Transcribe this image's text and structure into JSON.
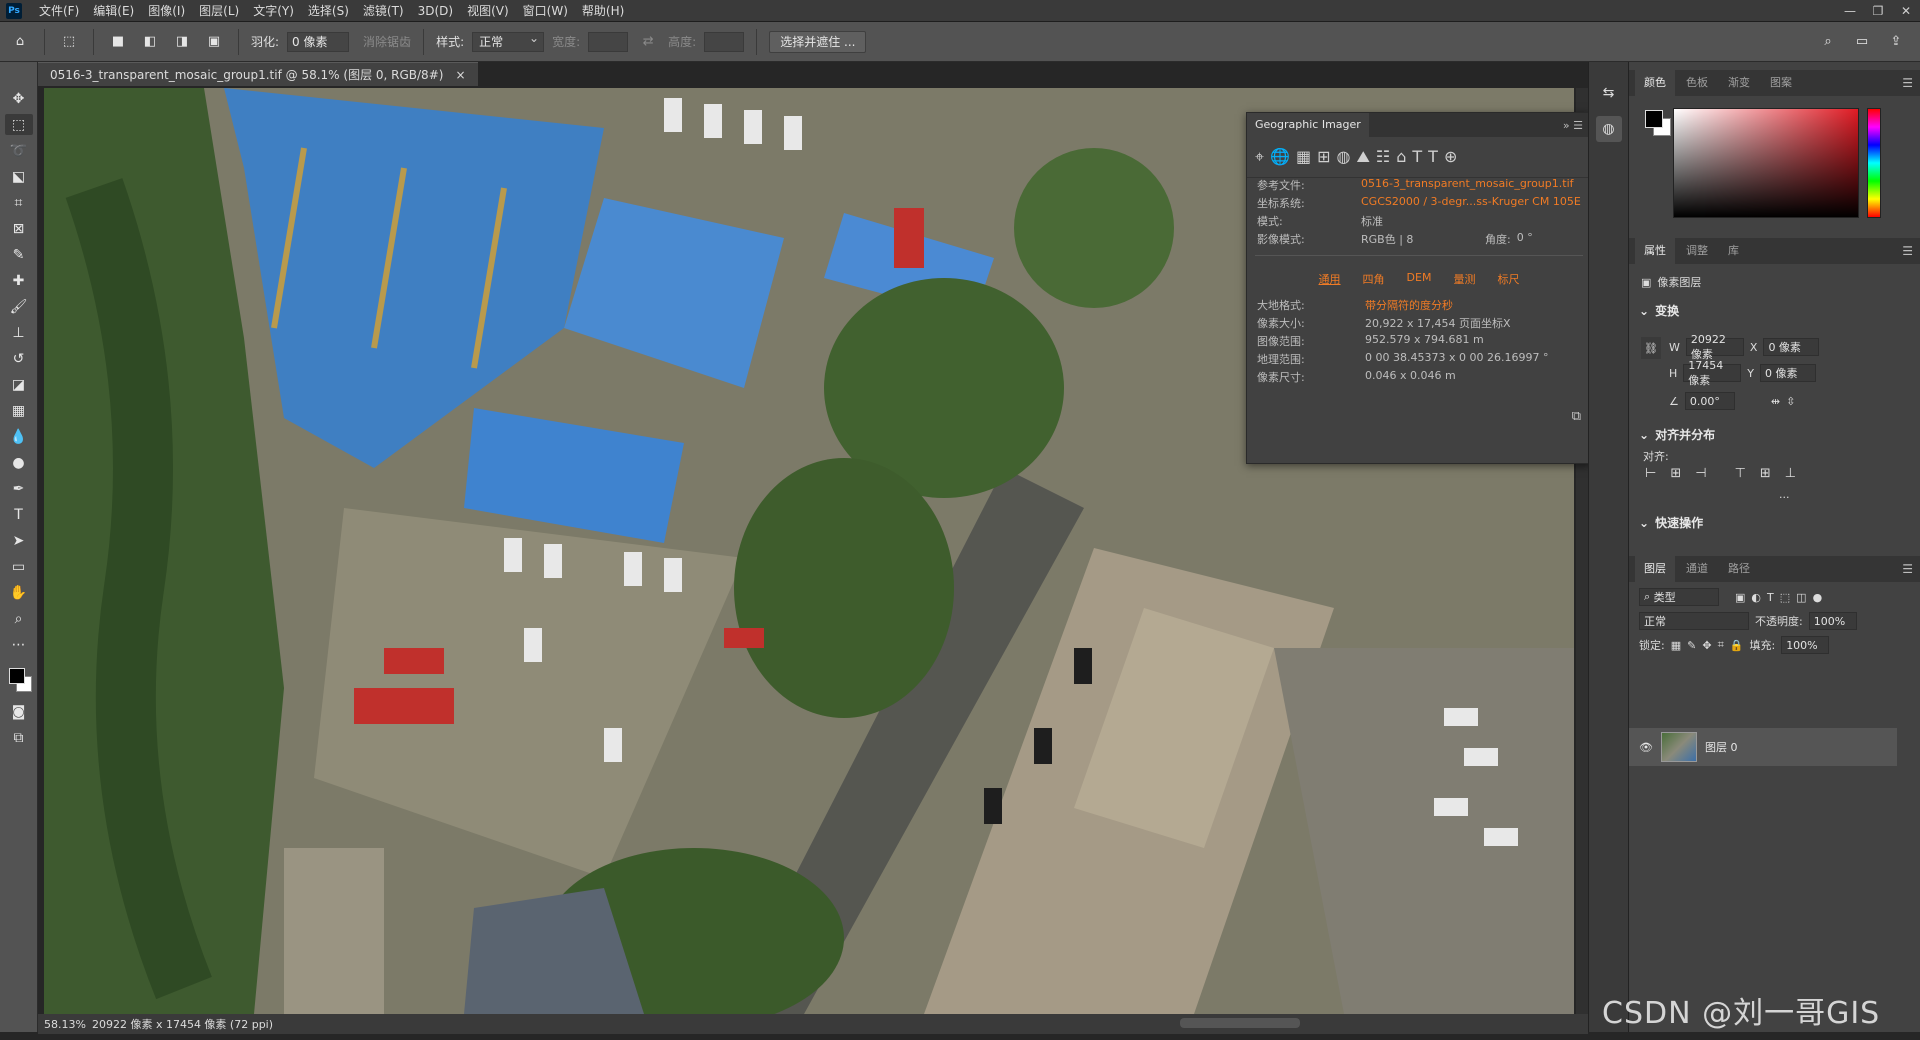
{
  "app": {
    "logo": "Ps"
  },
  "menu": [
    "文件(F)",
    "编辑(E)",
    "图像(I)",
    "图层(L)",
    "文字(Y)",
    "选择(S)",
    "滤镜(T)",
    "3D(D)",
    "视图(V)",
    "窗口(W)",
    "帮助(H)"
  ],
  "window_controls": [
    "—",
    "❐",
    "✕"
  ],
  "options": {
    "feather_label": "羽化:",
    "feather_value": "0 像素",
    "antialias_label": "消除锯齿",
    "style_label": "样式:",
    "style_value": "正常",
    "width_label": "宽度:",
    "height_label": "高度:",
    "select_mask_button": "选择并遮住 ..."
  },
  "document": {
    "tab_title": "0516-3_transparent_mosaic_group1.tif @ 58.1% (图层 0, RGB/8#)",
    "close": "×",
    "zoom_status": "58.13%",
    "size_status": "20922 像素 x 17454 像素 (72 ppi)"
  },
  "geo_panel": {
    "title": "Geographic Imager",
    "ref_file_label": "参考文件:",
    "ref_file_value": "0516-3_transparent_mosaic_group1.tif",
    "crs_label": "坐标系统:",
    "crs_value": "CGCS2000 / 3-degr...ss-Kruger CM 105E",
    "mode_label": "模式:",
    "mode_value": "标准",
    "image_mode_label": "影像模式:",
    "image_mode_value": "RGB色 | 8",
    "angle_label": "角度:",
    "angle_value": "0 °",
    "subtabs": [
      "通用",
      "四角",
      "DEM",
      "量测",
      "标尺"
    ],
    "geodetic_label": "大地格式:",
    "geodetic_value": "带分隔符的度分秒",
    "pixel_size_label": "像素大小:",
    "pixel_size_value": "20,922 x 17,454 页面坐标X",
    "image_range_label": "图像范围:",
    "image_range_value": "952.579 x 794.681 m",
    "geo_range_label": "地理范围:",
    "geo_range_value": "0 00 38.45373 x 0 00 26.16997 °",
    "cell_size_label": "像素尺寸:",
    "cell_size_value": "0.046 x 0.046 m"
  },
  "color_panel": {
    "tabs": [
      "颜色",
      "色板",
      "渐变",
      "图案"
    ]
  },
  "properties_panel": {
    "tabs": [
      "属性",
      "调整",
      "库"
    ],
    "layer_type": "像素图层",
    "transform_title": "变换",
    "w_label": "W",
    "w_value": "20922 像素",
    "h_label": "H",
    "h_value": "17454 像素",
    "x_label": "X",
    "x_value": "0 像素",
    "y_label": "Y",
    "y_value": "0 像素",
    "angle_value": "0.00°",
    "align_title": "对齐并分布",
    "align_label": "对齐:",
    "more": "...",
    "quick_title": "快速操作"
  },
  "layers_panel": {
    "tabs": [
      "图层",
      "通道",
      "路径"
    ],
    "filter_kind": "类型",
    "blend_mode": "正常",
    "opacity_label": "不透明度:",
    "opacity_value": "100%",
    "lock_label": "锁定:",
    "fill_label": "填充:",
    "fill_value": "100%",
    "layer_name": "图层 0"
  },
  "watermark": "CSDN @刘一哥GIS"
}
